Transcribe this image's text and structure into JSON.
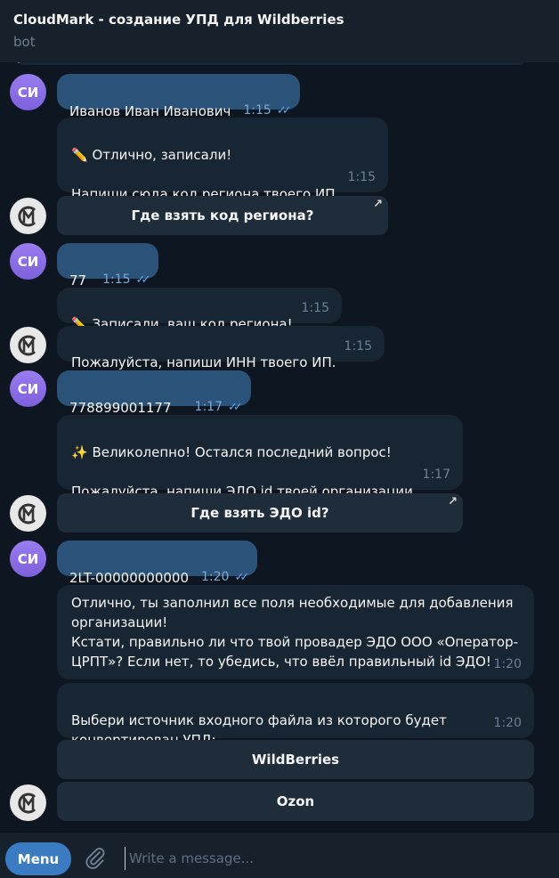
{
  "header": {
    "title": "CloudMark - создание УПД для Wildberries",
    "subtitle": "bot"
  },
  "avatars": {
    "user_initials": "СИ"
  },
  "messages": {
    "m1": {
      "text": "Иванов Иван Иванович",
      "time": "1:15"
    },
    "m2": {
      "text": "✏️ Отлично, записали!\n\nНапиши сюда код региона твоего ИП.",
      "time": "1:15"
    },
    "b1": {
      "label": "Где взять код региона?"
    },
    "m3": {
      "text": "77",
      "time": "1:15"
    },
    "m4": {
      "text": "✏️ Записали, ваш код региона!",
      "time": "1:15"
    },
    "m5": {
      "text": "Пожалуйста, напиши ИНН твоего ИП.",
      "time": "1:15"
    },
    "m6": {
      "text": "778899001177",
      "time": "1:17"
    },
    "m7": {
      "text": "✨ Великолепно! Остался последний вопрос!\n\nПожалуйста, напиши ЭДО id твоей организации.",
      "time": "1:17"
    },
    "b2": {
      "label": "Где взять ЭДО id?"
    },
    "m8": {
      "text": "2LT-00000000000",
      "time": "1:20"
    },
    "m9": {
      "text": "Отлично, ты заполнил все поля необходимые для добавления организации!\nКстати, правильно ли что твой провадер ЭДО ООО «Оператор-ЦРПТ»? Если нет, то убедись, что ввёл правильный id ЭДО!",
      "time": "1:20"
    },
    "m10": {
      "text": "Выбери источник входного файла из которого будет конвертирован УПД:",
      "time": "1:20"
    },
    "b3": {
      "label": "WildBerries"
    },
    "b4": {
      "label": "Ozon"
    }
  },
  "composer": {
    "menu_label": "Menu",
    "placeholder": "Write a message..."
  },
  "colors": {
    "outgoing": "#2b5278",
    "incoming": "#182533",
    "accent": "#3a7bc2"
  }
}
